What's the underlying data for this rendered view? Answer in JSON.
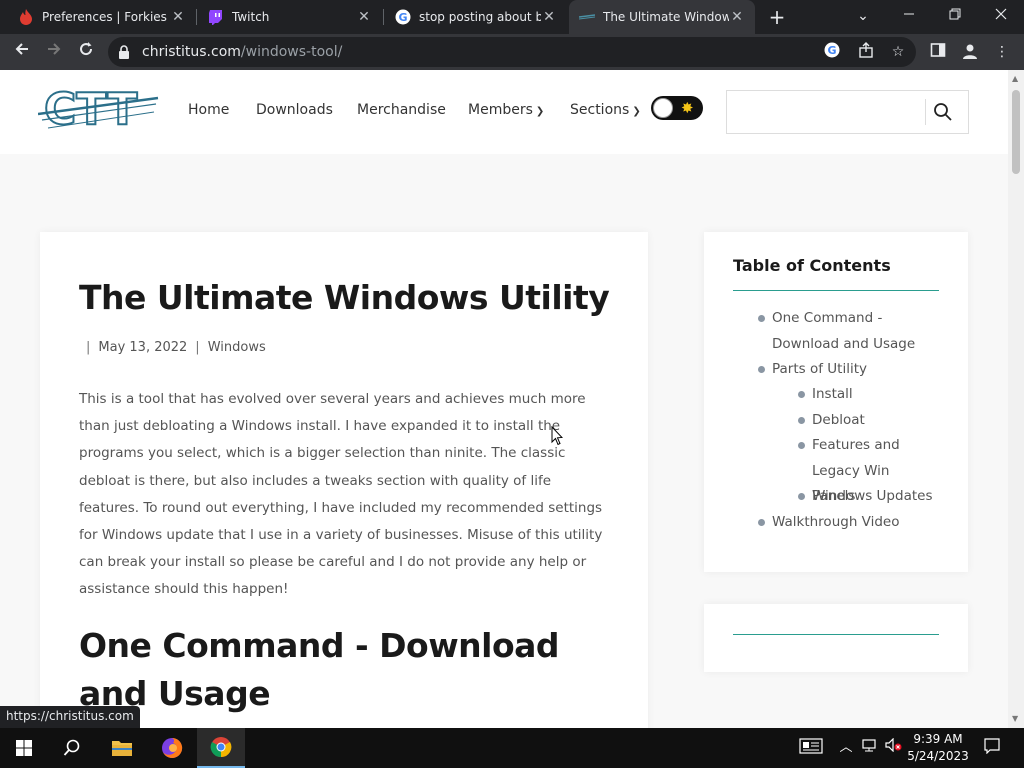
{
  "browser": {
    "tabs": [
      {
        "title": "Preferences | Forkies W",
        "favicon": "flame-icon"
      },
      {
        "title": "Twitch",
        "favicon": "twitch-icon"
      },
      {
        "title": "stop posting about bal",
        "favicon": "google-icon"
      },
      {
        "title": "The Ultimate Windows",
        "favicon": "ctt-icon",
        "active": true
      }
    ],
    "url_domain": "christitus.com",
    "url_path": "/windows-tool/",
    "status_url": "https://christitus.com"
  },
  "site": {
    "logo_text": "CTT",
    "nav": [
      {
        "label": "Home"
      },
      {
        "label": "Downloads"
      },
      {
        "label": "Merchandise"
      },
      {
        "label": "Members",
        "dropdown": true
      },
      {
        "label": "Sections",
        "dropdown": true
      }
    ],
    "search_placeholder": ""
  },
  "article": {
    "title": "The Ultimate Windows Utility",
    "meta_sep": "|",
    "date": "May 13, 2022",
    "category": "Windows",
    "intro": "This is a tool that has evolved over several years and achieves much more than just debloating a Windows install. I have expanded it to install the programs you select, which is a bigger selection than ninite. The classic debloat is there, but also includes a tweaks section with quality of life features. To round out everything, I have included my recommended settings for Windows update that I use in a variety of businesses. Misuse of this utility can break your install so please be careful and I do not provide any help or assistance should this happen!",
    "section_heading": "One Command - Download and Usage"
  },
  "toc": {
    "title": "Table of Contents",
    "items": [
      {
        "label": "One Command - Download and Usage",
        "level": 1
      },
      {
        "label": "Parts of Utility",
        "level": 1
      },
      {
        "label": "Install",
        "level": 2
      },
      {
        "label": "Debloat",
        "level": 2
      },
      {
        "label": "Features and Legacy Win Panels",
        "level": 2
      },
      {
        "label": "Windows Updates",
        "level": 2
      },
      {
        "label": "Walkthrough Video",
        "level": 1
      }
    ]
  },
  "taskbar": {
    "time": "9:39 AM",
    "date": "5/24/2023"
  },
  "colors": {
    "accent": "#2a9d8f",
    "tab_active": "#35363a",
    "chrome_bg": "#202124"
  }
}
